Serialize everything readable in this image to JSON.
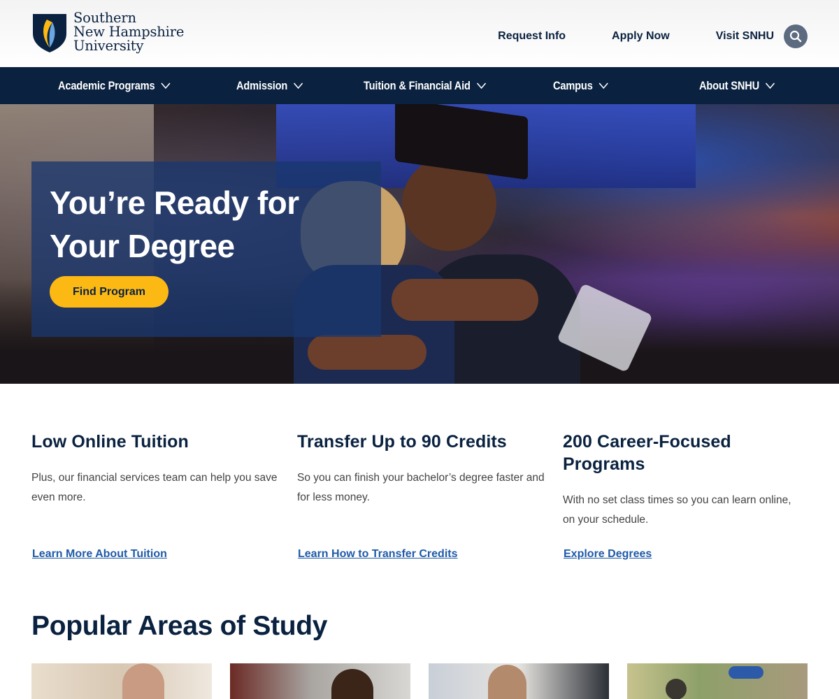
{
  "header": {
    "logo": {
      "line1": "Southern",
      "line2": "New Hampshire",
      "line3": "University"
    },
    "utility_links": [
      "Request Info",
      "Apply Now",
      "Visit SNHU"
    ],
    "search_icon": "search-icon"
  },
  "nav": {
    "items": [
      {
        "label": "Academic Programs"
      },
      {
        "label": "Admission"
      },
      {
        "label": "Tuition & Financial Aid"
      },
      {
        "label": "Campus"
      },
      {
        "label": "About SNHU"
      }
    ]
  },
  "hero": {
    "title_line1": "You’re Ready for",
    "title_line2": "Your Degree",
    "cta": "Find Program"
  },
  "features": [
    {
      "title": "Low Online Tuition",
      "text": "Plus, our financial services team can help you save even more.",
      "link": "Learn More About Tuition"
    },
    {
      "title": "Transfer Up to 90 Credits",
      "text": "So you can finish your bachelor’s degree faster and for less money.",
      "link": "Learn How to Transfer Credits"
    },
    {
      "title": "200 Career-Focused Programs",
      "text": "With no set class times so you can learn online, on your schedule.",
      "link": "Explore Degrees"
    }
  ],
  "popular": {
    "title": "Popular Areas of Study"
  },
  "colors": {
    "navy": "#0a2240",
    "gold": "#fdb913",
    "link": "#1f5aa8"
  }
}
